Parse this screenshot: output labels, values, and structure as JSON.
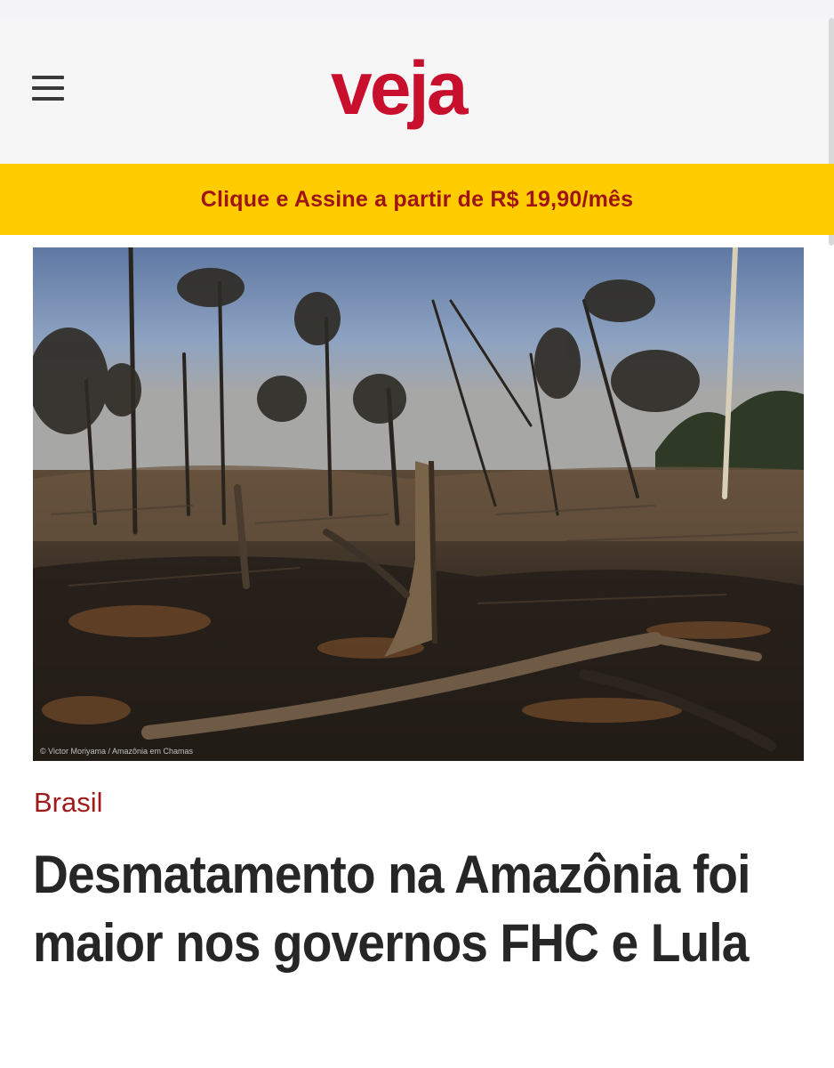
{
  "header": {
    "menu_icon": "hamburger-menu-icon",
    "logo_text": "veja"
  },
  "promo": {
    "text": "Clique e Assine a partir de R$ 19,90/mês"
  },
  "article": {
    "image_credit": "© Victor Moriyama / Amazônia em Chamas",
    "section": "Brasil",
    "headline": "Desmatamento na Amazônia foi maior nos governos FHC e Lula"
  },
  "colors": {
    "brand_red": "#c8102e",
    "promo_yellow": "#ffcc00",
    "promo_text": "#9e1414",
    "section_red": "#9e1a1a",
    "headline": "#262626"
  }
}
